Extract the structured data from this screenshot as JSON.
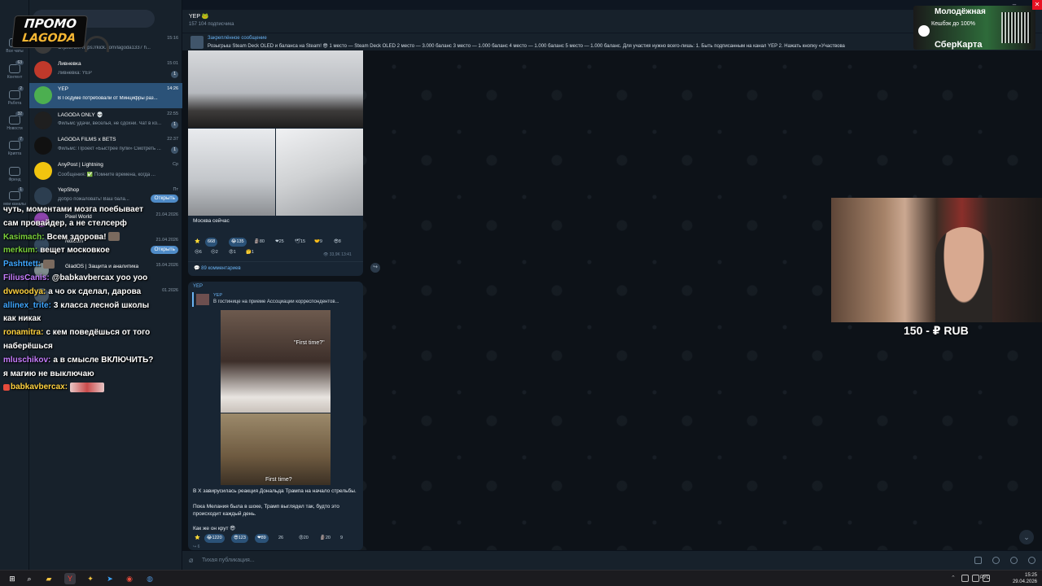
{
  "folders": [
    {
      "label": "Все чаты",
      "count": ""
    },
    {
      "label": "Контент",
      "count": "63"
    },
    {
      "label": "Работа",
      "count": "2"
    },
    {
      "label": "Новости",
      "count": "32"
    },
    {
      "label": "Крипта",
      "count": "7"
    },
    {
      "label": "Френд",
      "count": ""
    },
    {
      "label": "мои каналы",
      "count": "1"
    }
  ],
  "chats": [
    {
      "name": "",
      "preview": "Стрим on! https://kick.com/lagoda1337 h...",
      "time": "15:16",
      "badge": "",
      "color": "#3a3a3a"
    },
    {
      "name": "Ливневка",
      "preview": "Ливневка: YEP",
      "time": "15:01",
      "badge": "1",
      "color": "#c0392b"
    },
    {
      "name": "YEP",
      "preview": "В Госдуме потребовали от Минцифры раз...",
      "time": "14:26",
      "badge": "",
      "color": "#4caf50"
    },
    {
      "name": "LAGODA ONLY 💀",
      "preview": "Фильмс удачи, веселья, не сдохни. Чат в ко...",
      "time": "22:55",
      "badge": "1",
      "color": "#1f1f1f"
    },
    {
      "name": "LAGODA FILMS x BETS",
      "preview": "Фильмс: Проект «Быстрее пули» Смотреть ...",
      "time": "22:37",
      "badge": "1",
      "color": "#111111"
    },
    {
      "name": "AnyPost | Lightning",
      "preview": "Сообщения: ✅ Помните времена, когда ...",
      "time": "Ср",
      "badge": "",
      "color": "#f1c40f"
    },
    {
      "name": "YepShop",
      "preview": "Добро пожаловать! Ваш бала...",
      "time": "Пт",
      "badge": "",
      "color": "#2c3e50",
      "action": "Открыть"
    },
    {
      "name": "Pixel World",
      "preview": "",
      "time": "21.04.2026",
      "badge": "",
      "color": "#8e44ad"
    },
    {
      "name": "Notcoin",
      "preview": "",
      "time": "21.04.2026",
      "badge": "",
      "color": "#34495e",
      "action": "Открыть"
    },
    {
      "name": "GladOS | Защита и аналитика",
      "preview": "",
      "time": "15.04.2026",
      "badge": "",
      "color": "#7f8c8d"
    },
    {
      "name": "",
      "preview": "",
      "time": "01.2026",
      "badge": "",
      "color": "#445566"
    },
    {
      "name": "",
      "preview": "",
      "time": "",
      "badge": "",
      "color": "#3b4d5f"
    }
  ],
  "promo": {
    "line1": "ПРОМО",
    "line2": "LAGODA"
  },
  "stream_chat": [
    {
      "user": "",
      "user_color": "#ffffff",
      "text": "чуть, моментами мозга поебывает"
    },
    {
      "user": "",
      "user_color": "#ffffff",
      "text": "сам провайдер, а не стелсерф"
    },
    {
      "user": "Kasimach:",
      "user_color": "#7ad03a",
      "text": "Всем здорова!"
    },
    {
      "user": "merkum:",
      "user_color": "#7ad03a",
      "text": "вещет московкое"
    },
    {
      "user": "Pashttett:",
      "user_color": "#3ea6ff",
      "text": ""
    },
    {
      "user": "FiliusCanis:",
      "user_color": "#c77dff",
      "text": "@babkavbercax yoo yoo"
    },
    {
      "user": "dvwoodya:",
      "user_color": "#ffd23f",
      "text": "а чо ок сделал, дарова"
    },
    {
      "user": "allinex_trite:",
      "user_color": "#3ea6ff",
      "text": "3 класса лесной школы"
    },
    {
      "user": "",
      "user_color": "#ffffff",
      "text": "как никак"
    },
    {
      "user": "ronamitra:",
      "user_color": "#ffd23f",
      "text": "с кем поведёшься от того"
    },
    {
      "user": "",
      "user_color": "#ffffff",
      "text": "наберёшься"
    },
    {
      "user": "mluschikov:",
      "user_color": "#c77dff",
      "text": "а в смысле ВКЛЮЧИТЬ?"
    },
    {
      "user": "",
      "user_color": "#ffffff",
      "text": "я магию не выключаю"
    },
    {
      "user": "babkavbercax:",
      "user_color": "#ffd23f",
      "text": ""
    }
  ],
  "channel": {
    "title": "YEP 🐸",
    "subscribers": "157 104 подписчика",
    "pinned_title": "Закреплённое сообщение",
    "pinned_text": "Розыгрыш Steam Deck OLED и баланса на Steam! 😎 1 место — Steam Deck OLED 2 место — 3.000 баланс 3 место — 1.000 баланс 4 место — 1.000 баланс 5 место — 1.000 баланс. Для участия нужно всего-лишь: 1. Быть подписанным на канал YEP 2. Нажать кнопку «Участвова"
  },
  "post1": {
    "caption": "Москва сейчас",
    "reactions": [
      {
        "emoji": "⭐",
        "count": ""
      },
      {
        "emoji": "",
        "count": "668"
      },
      {
        "emoji": "😂",
        "count": "135"
      },
      {
        "emoji": "🗿",
        "count": "80"
      },
      {
        "emoji": "❤",
        "count": "25"
      },
      {
        "emoji": "🕊",
        "count": "15"
      },
      {
        "emoji": "🤝",
        "count": "9"
      },
      {
        "emoji": "😎",
        "count": "8"
      },
      {
        "emoji": "😢",
        "count": "6"
      },
      {
        "emoji": "😐",
        "count": "2"
      },
      {
        "emoji": "😡",
        "count": "1"
      },
      {
        "emoji": "🤔",
        "count": "1"
      }
    ],
    "views": "33,9K",
    "time": "13:41",
    "comments": "89 комментариев"
  },
  "post2": {
    "author": "YEP",
    "reply_author": "YEP",
    "reply_text": "В гостинице на приеме Ассоциации корреспондентов...",
    "meme_top_label": "\"First time?\"",
    "meme_bottom_label": "First time?",
    "text1": "В X завирусилась реакция Дональда Трампа на начало стрельбы.",
    "text2": "Пока Мелания была в шоке, Трамп выглядел так, будто это происходит каждый день.",
    "text3": "Как же он крут 😎",
    "reactions": [
      {
        "emoji": "⭐",
        "count": ""
      },
      {
        "emoji": "😂",
        "count": "1220"
      },
      {
        "emoji": "😎",
        "count": "123"
      },
      {
        "emoji": "❤",
        "count": "89"
      },
      {
        "emoji": "",
        "count": "26"
      },
      {
        "emoji": "😡",
        "count": "20"
      },
      {
        "emoji": "🗿",
        "count": "20"
      },
      {
        "emoji": "👍",
        "count": "9"
      }
    ],
    "more": "6"
  },
  "composer": {
    "placeholder": "Тихая публикация..."
  },
  "donation": {
    "text": "150 - ₽ RUB"
  },
  "ad": {
    "line1": "Молодёжная",
    "line2": "Кешбэк до 100%",
    "line3": "СберКарта"
  },
  "taskbar": {
    "lang": "РУС",
    "time": "15:25",
    "date": "29.04.2026"
  }
}
